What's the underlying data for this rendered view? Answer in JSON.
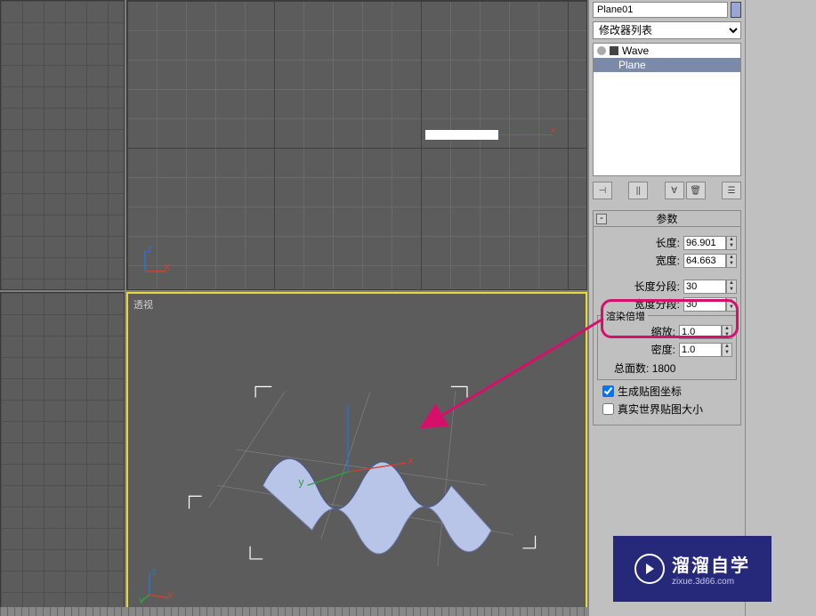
{
  "object_name": "Plane01",
  "modifier_dropdown": "修改器列表",
  "stack": {
    "wave": "Wave",
    "plane": "Plane"
  },
  "viewport": {
    "perspective_label": "透视",
    "x_axis": "x"
  },
  "rollout": {
    "title": "参数",
    "length_label": "长度:",
    "length_value": "96.901",
    "width_label": "宽度:",
    "width_value": "64.663",
    "length_segs_label": "长度分段:",
    "length_segs_value": "30",
    "width_segs_label": "宽度分段:",
    "width_segs_value": "30",
    "render_group": "渲染倍增",
    "scale_label": "缩放:",
    "scale_value": "1.0",
    "density_label": "密度:",
    "density_value": "1.0",
    "total_faces_label": "总面数:",
    "total_faces_value": "1800",
    "gen_uv": "生成贴图坐标",
    "real_world": "真实世界贴图大小"
  },
  "watermark": {
    "title": "溜溜自学",
    "url": "zixue.3d66.com"
  }
}
